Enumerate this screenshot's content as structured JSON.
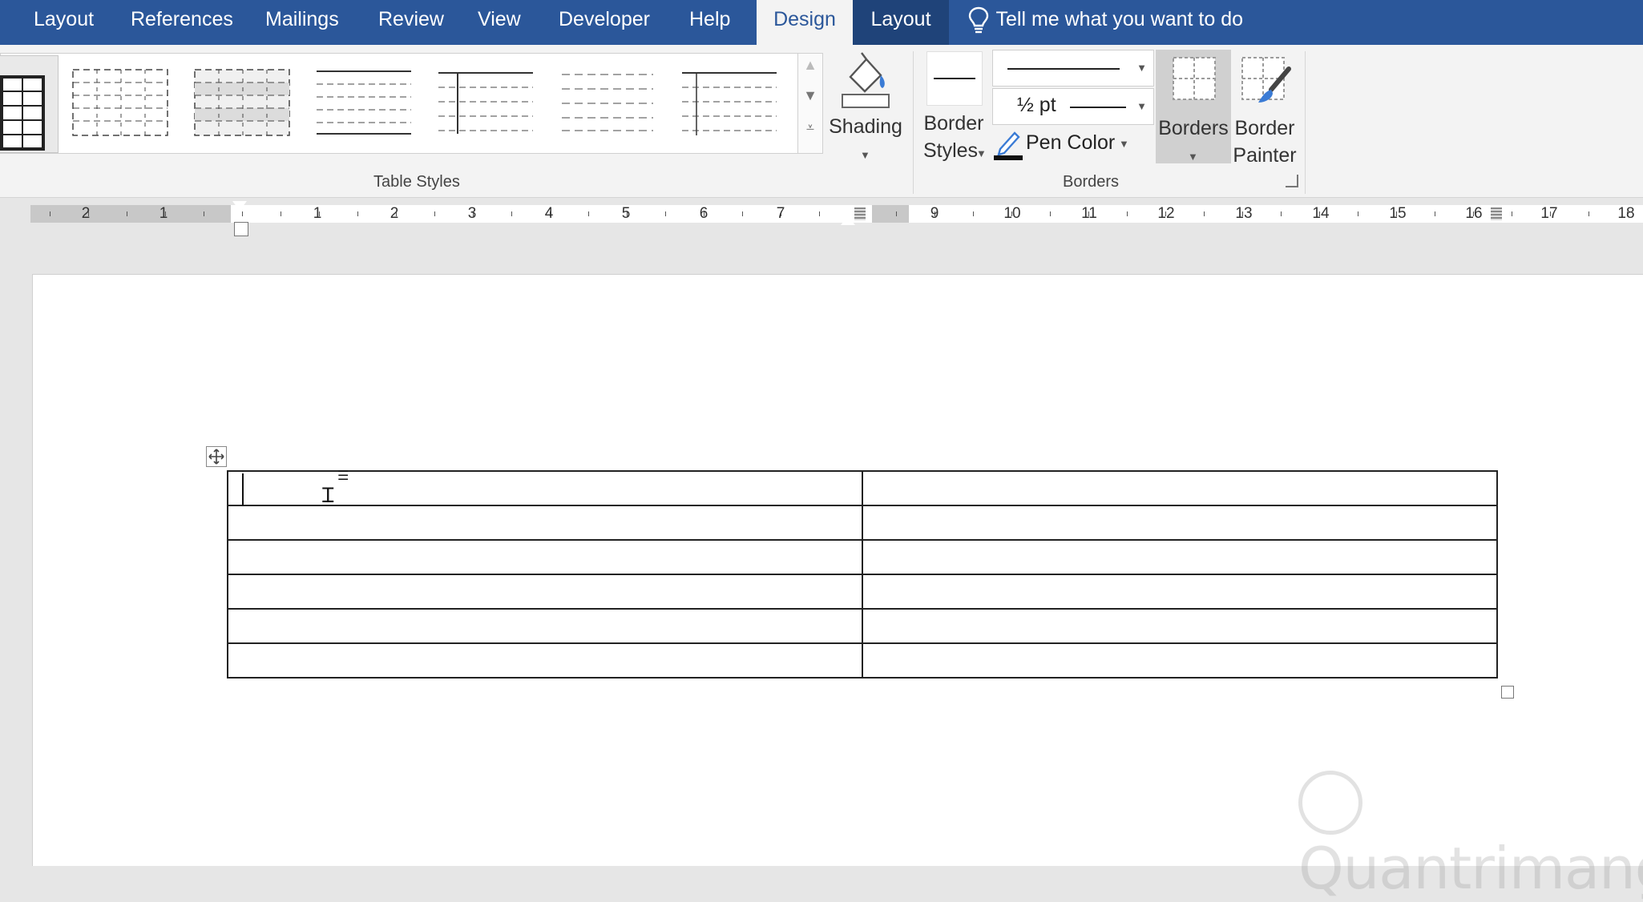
{
  "tabs": {
    "items": [
      {
        "label": "Layout"
      },
      {
        "label": "References"
      },
      {
        "label": "Mailings"
      },
      {
        "label": "Review"
      },
      {
        "label": "View"
      },
      {
        "label": "Developer"
      },
      {
        "label": "Help"
      },
      {
        "label": "Design"
      },
      {
        "label": "Layout"
      }
    ],
    "tell_me": "Tell me what you want to do"
  },
  "ribbon": {
    "table_styles_label": "Table Styles",
    "shading_label": "Shading",
    "border_styles_label_1": "Border",
    "border_styles_label_2": "Styles",
    "pen_weight_value": "½ pt",
    "pen_color_label": "Pen Color",
    "borders_button_label": "Borders",
    "border_painter_label_1": "Border",
    "border_painter_label_2": "Painter",
    "borders_group_label": "Borders"
  },
  "ruler": {
    "left_numbers": [
      "2",
      "1"
    ],
    "numbers": [
      "1",
      "2",
      "3",
      "4",
      "5",
      "6",
      "7",
      "9",
      "10",
      "11",
      "12",
      "13",
      "14",
      "15",
      "16",
      "17",
      "18"
    ]
  },
  "document": {
    "table": {
      "rows": 6,
      "columns": 2
    }
  },
  "watermark": "Quantrimang"
}
